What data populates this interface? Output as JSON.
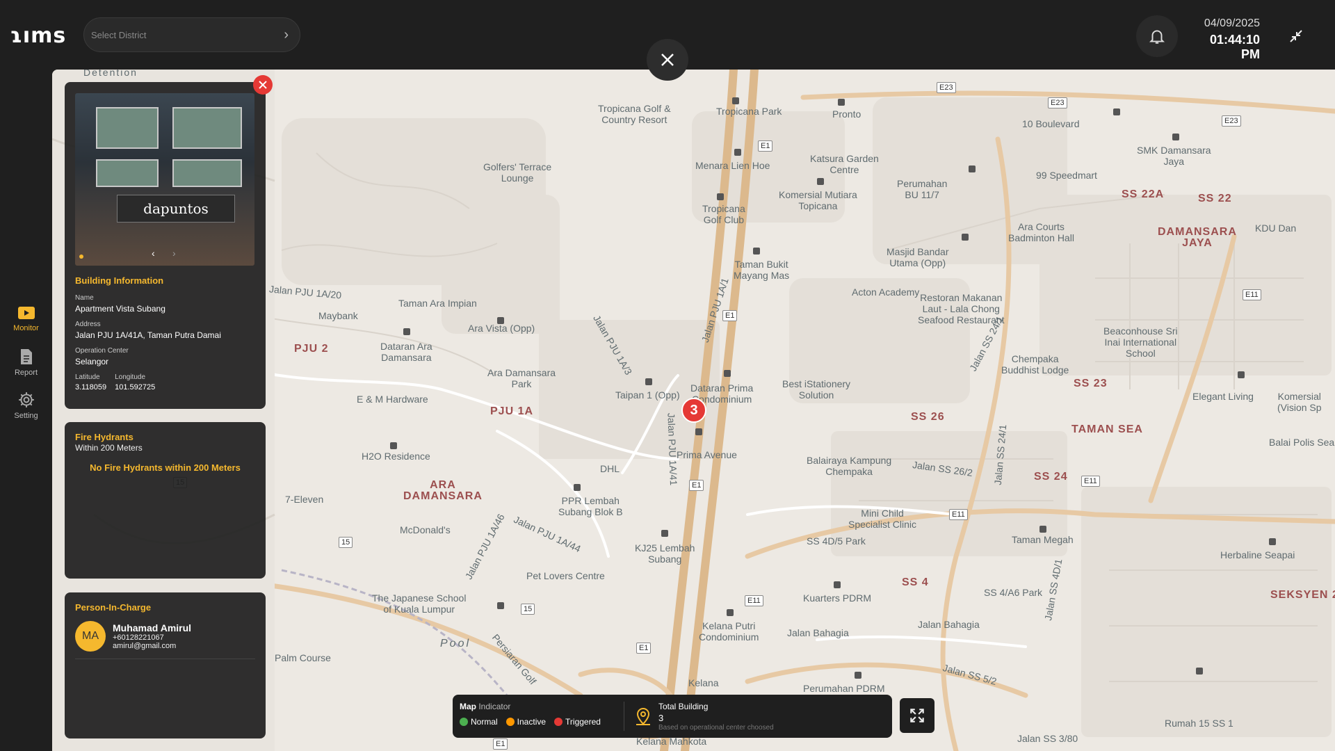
{
  "app": {
    "logo": "RIMS"
  },
  "header": {
    "district_placeholder": "Select District",
    "date": "04/09/2025",
    "time": "01:44:10 PM"
  },
  "sidebar": {
    "items": [
      {
        "label": "Monitor",
        "icon": "monitor-icon",
        "active": true
      },
      {
        "label": "Report",
        "icon": "report-icon",
        "active": false
      },
      {
        "label": "Setting",
        "icon": "gear-icon",
        "active": false
      }
    ]
  },
  "building": {
    "section_title": "Building Information",
    "photo_sign": "dapuntos",
    "name_label": "Name",
    "name": "Apartment Vista Subang",
    "address_label": "Address",
    "address": "Jalan PJU 1A/41A, Taman Putra Damai",
    "opcenter_label": "Operation Center",
    "opcenter": "Selangor",
    "lat_label": "Latitude",
    "lat": "3.118059",
    "lng_label": "Longitude",
    "lng": "101.592725"
  },
  "hydrants": {
    "title": "Fire Hydrants",
    "subtitle": "Within 200 Meters",
    "empty": "No Fire Hydrants within 200 Meters"
  },
  "pic": {
    "title": "Person-In-Charge",
    "initials": "MA",
    "name": "Muhamad Amirul",
    "phone": "+60128221067",
    "email": "amirul@gmail.com"
  },
  "map": {
    "cluster_count": "3",
    "labels": [
      {
        "text": "Tropicana Golf &\nCountry Resort"
      },
      {
        "text": "Tropicana Park"
      },
      {
        "text": "Golfers' Terrace\nLounge"
      },
      {
        "text": "Menara Lien Hoe"
      },
      {
        "text": "Katsura Garden\nCentre"
      },
      {
        "text": "Pronto"
      },
      {
        "text": "10 Boulevard"
      },
      {
        "text": "SMK Damansara\nJaya"
      },
      {
        "text": "99 Speedmart"
      },
      {
        "text": "Perumahan\nBU 11/7"
      },
      {
        "text": "Komersial Mutiara\nTopicana"
      },
      {
        "text": "Tropicana\nGolf Club"
      },
      {
        "text": "Ara Courts\nBadminton Hall"
      },
      {
        "text": "Masjid Bandar\nUtama (Opp)"
      },
      {
        "text": "Taman Bukit\nMayang Mas"
      },
      {
        "text": "Acton Academy"
      },
      {
        "text": "Restoran Makanan\nLaut - Lala Chong\nSeafood Restaurant"
      },
      {
        "text": "Beaconhouse Sri\nInai International\nSchool"
      },
      {
        "text": "Chempaka\nBuddhist Lodge"
      },
      {
        "text": "Taman Ara Impian"
      },
      {
        "text": "Maybank"
      },
      {
        "text": "Ara Vista (Opp)"
      },
      {
        "text": "Dataran Ara\nDamansara"
      },
      {
        "text": "Ara Damansara\nPark"
      },
      {
        "text": "E & M Hardware"
      },
      {
        "text": "Taipan 1 (Opp)"
      },
      {
        "text": "Dataran Prima\nCondominium"
      },
      {
        "text": "Best iStationery\nSolution"
      },
      {
        "text": "Prima Avenue"
      },
      {
        "text": "Balairaya Kampung\nChempaka"
      },
      {
        "text": "H2O Residence"
      },
      {
        "text": "DHL"
      },
      {
        "text": "7-Eleven"
      },
      {
        "text": "PPR Lembah\nSubang Blok B"
      },
      {
        "text": "McDonald's"
      },
      {
        "text": "KJ25 Lembah\nSubang"
      },
      {
        "text": "Mini Child\nSpecialist Clinic"
      },
      {
        "text": "SS 4D/5 Park"
      },
      {
        "text": "Taman Megah"
      },
      {
        "text": "Pet Lovers Centre"
      },
      {
        "text": "The Japanese School\nof Kuala Lumpur"
      },
      {
        "text": "SS 4/A6 Park"
      },
      {
        "text": "Kuarters PDRM"
      },
      {
        "text": "Kelana Putri\nCondominium"
      },
      {
        "text": "Jalan Bahagia"
      },
      {
        "text": "Jalan Bahagia"
      },
      {
        "text": "Palm Course"
      },
      {
        "text": "Perumahan PDRM"
      },
      {
        "text": "Kelana"
      },
      {
        "text": "Kelana Mahkota"
      },
      {
        "text": "Rumah 15 SS 1"
      },
      {
        "text": "Herbaline Seapai"
      },
      {
        "text": "Balai Polis Seap"
      },
      {
        "text": "Elegant Living"
      },
      {
        "text": "KDU Dan"
      },
      {
        "text": "Komersial\n(Vision Sp"
      },
      {
        "text": "Detention"
      },
      {
        "text": "Pool"
      }
    ],
    "districts": [
      {
        "text": "PJU 2"
      },
      {
        "text": "PJU 1A"
      },
      {
        "text": "ARA\nDAMANSARA"
      },
      {
        "text": "SS 22A"
      },
      {
        "text": "SS 22"
      },
      {
        "text": "DAMANSARA\nJAYA"
      },
      {
        "text": "SS 23"
      },
      {
        "text": "SS 26"
      },
      {
        "text": "TAMAN SEA"
      },
      {
        "text": "SS 24"
      },
      {
        "text": "SS 4"
      },
      {
        "text": "SEKSYEN 2"
      }
    ],
    "roads": [
      {
        "text": "Jalan PJU 1A/20"
      },
      {
        "text": "Jalan PJU 1A/3"
      },
      {
        "text": "Jalan PJU 1A/1"
      },
      {
        "text": "Jalan PJU 1A/41"
      },
      {
        "text": "Jalan PJU 1A/46"
      },
      {
        "text": "Jalan PJU 1A/44"
      },
      {
        "text": "Jalan SS 26/2"
      },
      {
        "text": "Jalan SS 24/1"
      },
      {
        "text": "Jalan SS 24/1"
      },
      {
        "text": "Jalan SS 4D/1"
      },
      {
        "text": "Jalan SS 5/2"
      },
      {
        "text": "Jalan SS 3/80"
      },
      {
        "text": "Persiaran Golf"
      }
    ],
    "badges": [
      "E23",
      "E23",
      "E23",
      "E1",
      "E1",
      "E1",
      "E1",
      "E11",
      "E11",
      "E11",
      "E11",
      "15",
      "15",
      "15",
      "E1"
    ]
  },
  "indicator": {
    "title": "Map",
    "subtitle": "Indicator",
    "legend": [
      {
        "label": "Normal",
        "color": "#4caf50"
      },
      {
        "label": "Inactive",
        "color": "#ff9800"
      },
      {
        "label": "Triggered",
        "color": "#e53935"
      }
    ],
    "total_title": "Total Building",
    "total_count": "3",
    "note": "Based on operational center choosed"
  }
}
